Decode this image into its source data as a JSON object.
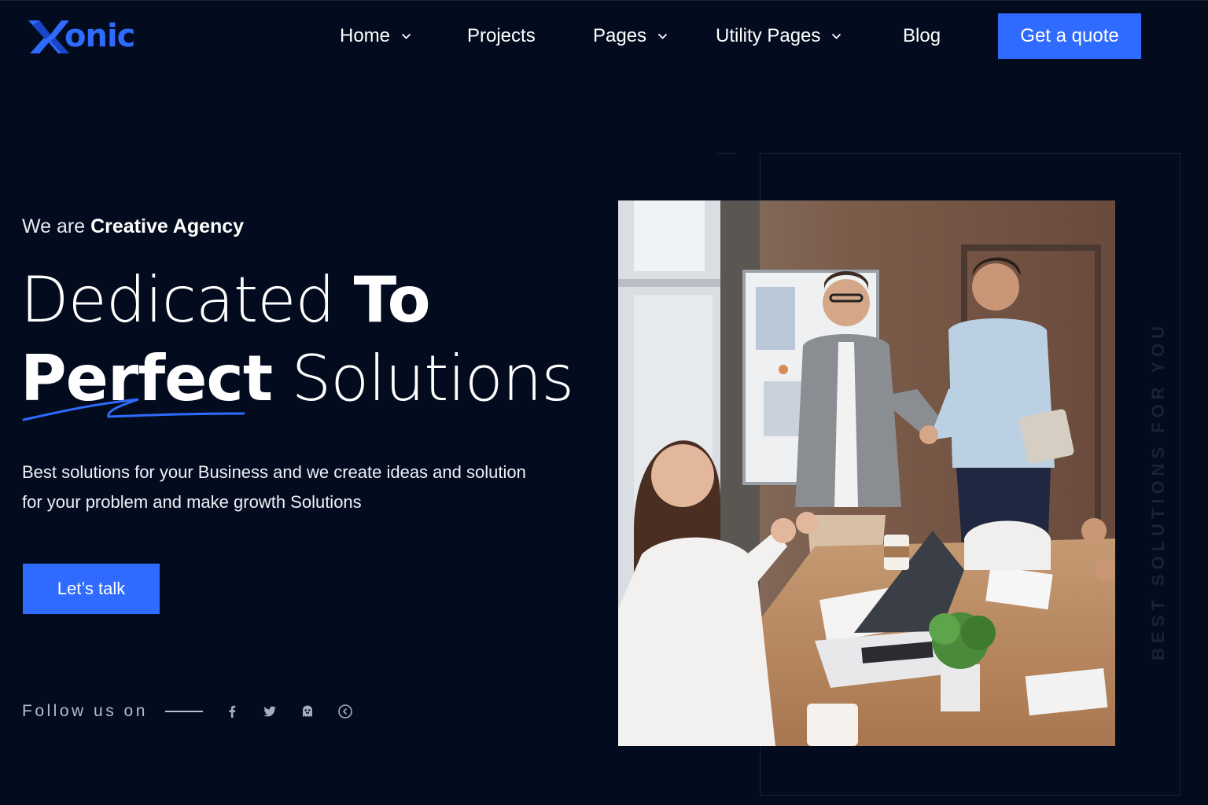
{
  "brand": {
    "logo_letter": "X",
    "logo_rest": "onic",
    "accent_color": "#2f6bff",
    "background_color": "#030c1f"
  },
  "nav": {
    "items": [
      {
        "label": "Home",
        "has_dropdown": true
      },
      {
        "label": "Projects",
        "has_dropdown": false
      },
      {
        "label": "Pages",
        "has_dropdown": true
      },
      {
        "label": "Utility Pages",
        "has_dropdown": true
      },
      {
        "label": "Blog",
        "has_dropdown": false
      }
    ],
    "cta_label": "Get a quote"
  },
  "hero": {
    "eyebrow_prefix": "We are",
    "eyebrow_highlight": "Creative Agency",
    "headline": {
      "word1": "Dedicated",
      "word2": "To",
      "word3": "Perfect",
      "word4": "Solutions"
    },
    "description": "Best solutions for your Business and we create ideas and solution for your problem and make growth Solutions",
    "cta_label": "Let’s talk",
    "follow_label": "Follow us on",
    "social_icons": [
      "facebook-icon",
      "twitter-icon",
      "ghost-icon",
      "arrow-circle-icon"
    ],
    "vertical_text": "BEST SOLUTIONS FOR YOU",
    "image_description": "team-meeting-handshake-photo"
  }
}
